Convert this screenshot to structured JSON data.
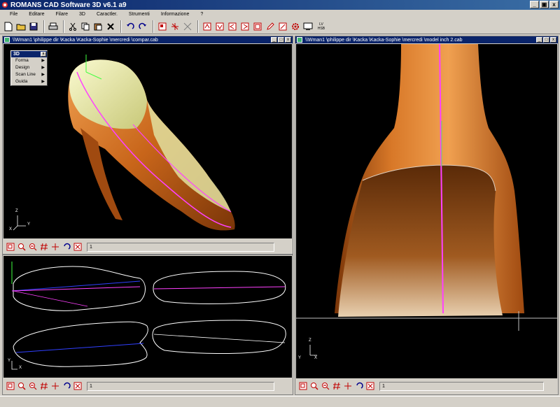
{
  "app": {
    "title": "ROMANS CAD Software 3D v6.1 a9"
  },
  "window_buttons": {
    "minimize": "_",
    "restore": "▣",
    "close": "x"
  },
  "menu": [
    "File",
    "Editare",
    "Filare",
    "3D",
    "Caractler.",
    "Strumenti",
    "Informazione",
    "?"
  ],
  "toolbar_extra_label": "LV\nHSB",
  "left_top_window": {
    "title": "\\\\Wman1 \\philippe dir \\Kacka \\Kacka-Sophie \\mercredi \\compar.cab",
    "input_value": "1"
  },
  "left_bottom_window": {
    "input_value": "1"
  },
  "right_window": {
    "title": "\\\\Wman1 \\philippe dir \\Kacka \\Kacka-Sophie \\mercredi \\model inch 2.cab",
    "input_value": "1"
  },
  "popup_menu": {
    "title": "3D",
    "items": [
      "Forma",
      "Design",
      "Scan Line",
      "Guida"
    ]
  },
  "axis_labels": {
    "x": "X",
    "y": "Y",
    "z": "Z"
  },
  "colors": {
    "titlebar": "#0a246a",
    "viewport_bg": "#000000",
    "shoe_orange": "#c8651a",
    "shoe_yellow": "#e8e8a0",
    "magenta_line": "#ff40ff",
    "blue_line": "#3040ff"
  }
}
